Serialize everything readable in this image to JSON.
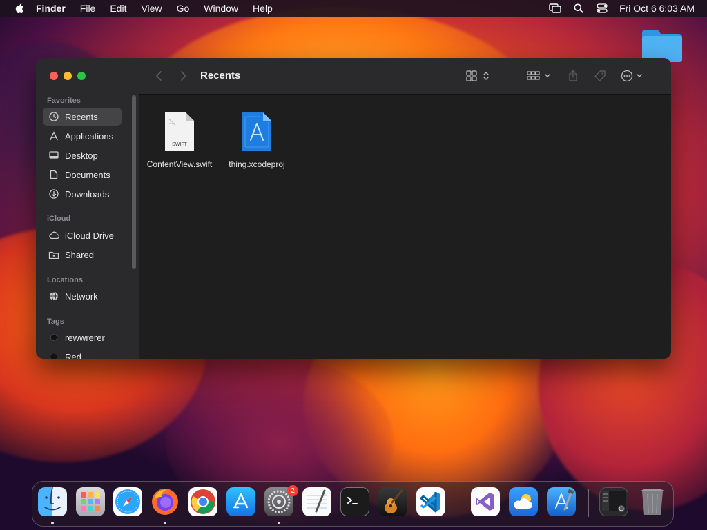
{
  "menubar": {
    "app_name": "Finder",
    "items": [
      "File",
      "Edit",
      "View",
      "Go",
      "Window",
      "Help"
    ],
    "clock": "Fri Oct 6  6:03 AM"
  },
  "window": {
    "title": "Recents",
    "sidebar": {
      "favorites_label": "Favorites",
      "favorites": [
        "Recents",
        "Applications",
        "Desktop",
        "Documents",
        "Downloads"
      ],
      "icloud_label": "iCloud",
      "icloud": [
        "iCloud Drive",
        "Shared"
      ],
      "locations_label": "Locations",
      "locations": [
        "Network"
      ],
      "tags_label": "Tags",
      "tags": [
        "rewwrerer",
        "Red"
      ]
    },
    "files": [
      {
        "name": "ContentView.swift",
        "badge": "SWIFT"
      },
      {
        "name": "thing.xcodeproj"
      }
    ]
  },
  "dock": {
    "apps": [
      "Finder",
      "Launchpad",
      "Safari",
      "Firefox",
      "Chrome",
      "App Store",
      "System Settings",
      "TextEdit",
      "Terminal",
      "GarageBand",
      "Visual Studio Code",
      "Visual Studio",
      "Weather",
      "Xcode",
      "Screenshot",
      "Trash"
    ],
    "settings_badge": "2"
  },
  "colors": {
    "accent": "#0a84ff",
    "window_bg": "#1e1e1e",
    "sidebar_bg": "#2a2a2c"
  }
}
